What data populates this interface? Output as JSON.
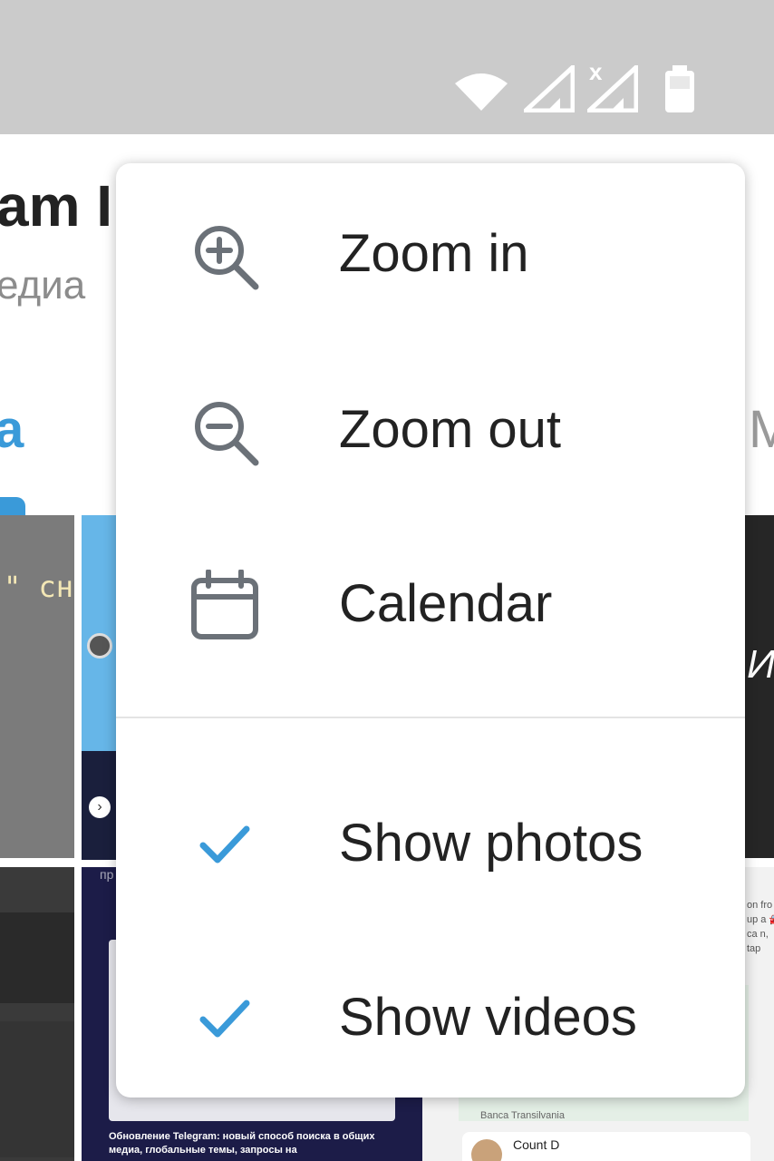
{
  "status_bar": {
    "icons": [
      "wifi-icon",
      "cell-signal-icon",
      "cell-signal-no-service-icon",
      "battery-icon"
    ],
    "no_service_mark": "x",
    "background": "#cbcbcb"
  },
  "background_screen": {
    "title_fragment": "am I",
    "subtitle_fragment": "едиа",
    "tab_left_fragment": "a",
    "tab_right_fragment": "M",
    "tile_texts": {
      "tile1": "\" сно",
      "tile3_badge": "›",
      "tile5_top": "пр",
      "tile5_caption": "Обновление Telegram: новый способ поиска в общих медиа, глобальные темы, запросы на",
      "tile6_right": "on fro s up a 🚘 ca n, tap",
      "tile6_bank": "Banca Transilvania",
      "tile6_name": "Count D",
      "tile7_glyph": "И"
    },
    "accent_color": "#3a9ad9"
  },
  "menu": {
    "items": [
      {
        "label": "Zoom in",
        "icon": "zoom-in-icon"
      },
      {
        "label": "Zoom out",
        "icon": "zoom-out-icon"
      },
      {
        "label": "Calendar",
        "icon": "calendar-icon"
      },
      {
        "label": "Show photos",
        "icon": "check-icon",
        "checked": true
      },
      {
        "label": "Show videos",
        "icon": "check-icon",
        "checked": true
      }
    ],
    "icon_color": "#6b7178",
    "check_color": "#3a9ad9"
  }
}
